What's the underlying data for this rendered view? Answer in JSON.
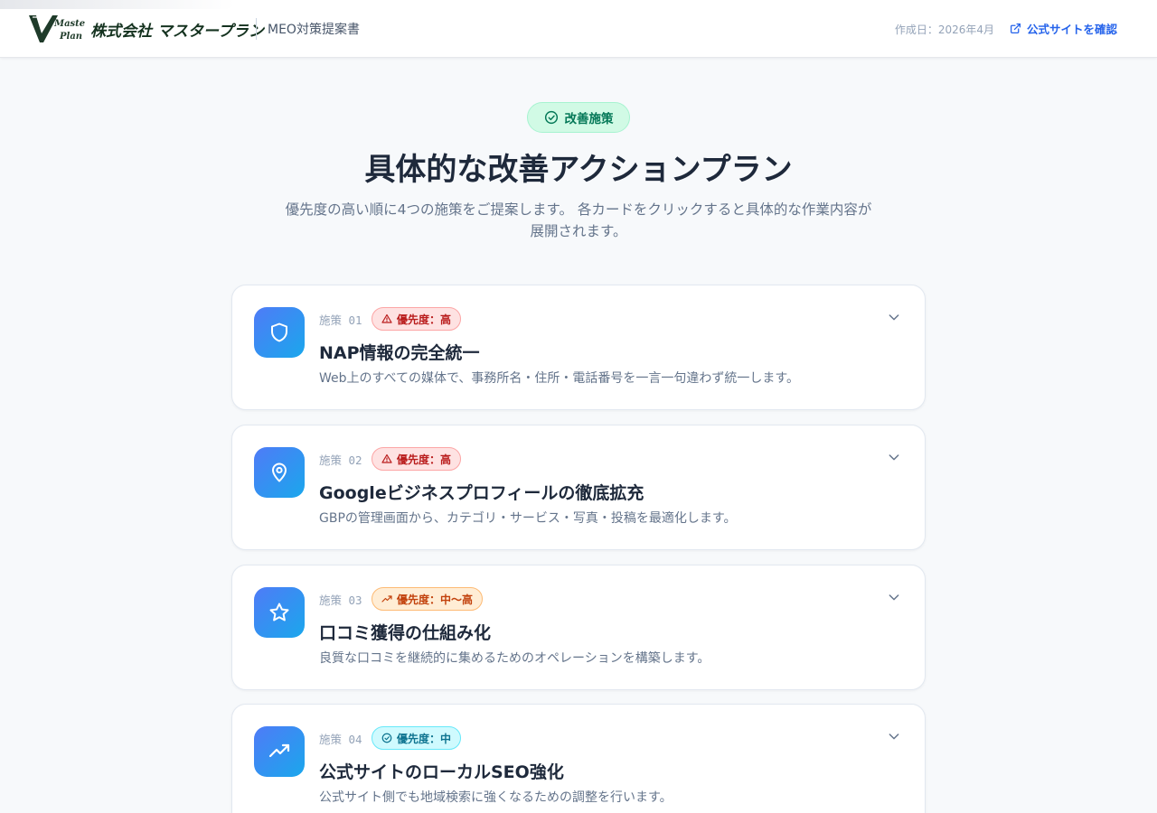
{
  "header": {
    "logo_mark_text": "Master Plan",
    "company_name": "株式会社 マスタープラン",
    "doc_title": "MEO対策提案書",
    "date": "作成日：2026年4月",
    "site_link": "公式サイトを確認"
  },
  "section": {
    "badge": "改善施策",
    "title": "具体的な改善アクションプラン",
    "desc_line1": "優先度の高い順に4つの施策をご提案します。 各カードをクリックすると具体的な作業内容が",
    "desc_line2": "展開されます。"
  },
  "colors": {
    "accent": "#2563eb",
    "badge_green": "#047857",
    "priority_high": "#b91c1c",
    "priority_midhigh": "#c2410c",
    "priority_mid": "#0e7490",
    "icon_gradient_start": "#4f7bf7",
    "icon_gradient_end": "#1aa7ec"
  },
  "cards": [
    {
      "number": "施策 01",
      "priority": "優先度：高",
      "priority_level": "high",
      "priority_icon": "alert-triangle-icon",
      "icon": "shield-icon",
      "title": "NAP情報の完全統一",
      "desc": "Web上のすべての媒体で、事務所名・住所・電話番号を一言一句違わず統一します。"
    },
    {
      "number": "施策 02",
      "priority": "優先度：高",
      "priority_level": "high",
      "priority_icon": "alert-triangle-icon",
      "icon": "map-pin-icon",
      "title": "Googleビジネスプロフィールの徹底拡充",
      "desc": "GBPの管理画面から、カテゴリ・サービス・写真・投稿を最適化します。"
    },
    {
      "number": "施策 03",
      "priority": "優先度：中〜高",
      "priority_level": "mid-high",
      "priority_icon": "trending-up-icon",
      "icon": "star-icon",
      "title": "口コミ獲得の仕組み化",
      "desc": "良質な口コミを継続的に集めるためのオペレーションを構築します。"
    },
    {
      "number": "施策 04",
      "priority": "優先度：中",
      "priority_level": "mid",
      "priority_icon": "check-circle-icon",
      "icon": "trending-up-icon",
      "title": "公式サイトのローカルSEO強化",
      "desc": "公式サイト側でも地域検索に強くなるための調整を行います。"
    }
  ]
}
